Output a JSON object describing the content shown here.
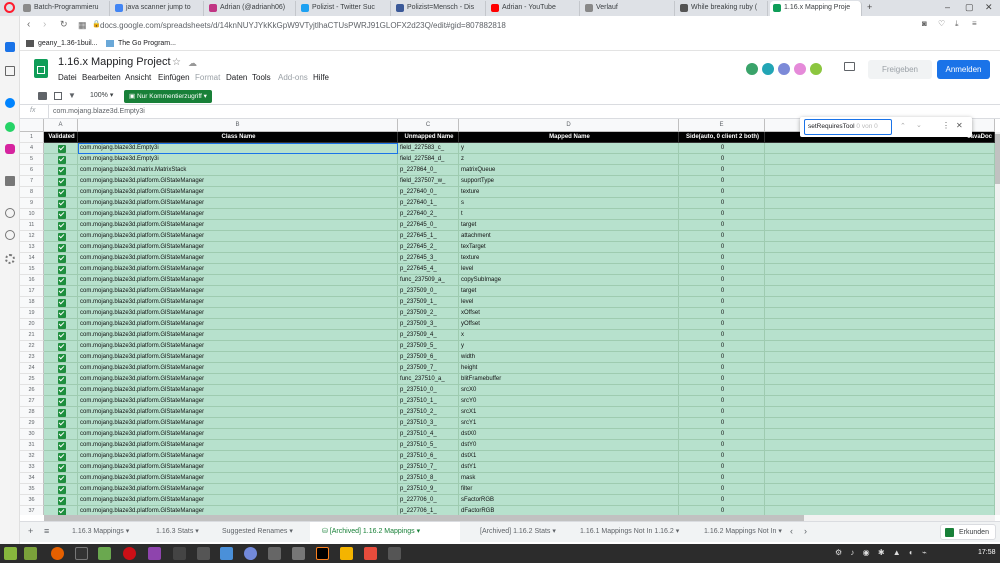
{
  "browser": {
    "tabs": [
      {
        "label": "Batch-Programmieru",
        "color": "#8a8a8a"
      },
      {
        "label": "java scanner jump to",
        "color": "#4285f4"
      },
      {
        "label": "Adrian (@adrianh06)",
        "color": "#c13584"
      },
      {
        "label": "Polizist - Twitter Suc",
        "color": "#1da1f2"
      },
      {
        "label": "Polizist=Mensch - Dis",
        "color": "#3b5998"
      },
      {
        "label": "Adrian - YouTube",
        "color": "#ff0000"
      },
      {
        "label": "Verlauf",
        "color": "#888888"
      },
      {
        "label": "While breaking ruby (",
        "color": "#555555"
      },
      {
        "label": "1.16.x Mapping Proje",
        "color": "#0f9d58"
      }
    ],
    "url": "docs.google.com/spreadsheets/d/14knNUYJYkKkGpW9VTyjtlhaCTUsPWRJ91GLOFX2d23Q/edit#gid=807882818",
    "bookmarks": [
      "geany_1.36-1buil...",
      "The Go Program..."
    ]
  },
  "docs": {
    "title": "1.16.x Mapping Project",
    "menu": [
      "Datei",
      "Bearbeiten",
      "Ansicht",
      "Einfügen",
      "Format",
      "Daten",
      "Tools",
      "Add-ons",
      "Hilfe"
    ],
    "share_button": "Freigeben",
    "signin_button": "Anmelden",
    "zoom": "100%",
    "mode": "Nur Kommentierzugriff",
    "formula_label": "fx",
    "formula_value": "com.mojang.blaze3d.Empty3i"
  },
  "find": {
    "query": "setRequiresTool",
    "count": "0 von 0"
  },
  "grid": {
    "col_letters": [
      "A",
      "B",
      "C",
      "D",
      "E"
    ],
    "headers": [
      "Validated",
      "Class Name",
      "Unmapped Name",
      "Mapped Name",
      "Side(auto, 0 client 2 both)",
      "JavaDoc"
    ],
    "header_rownum": "1",
    "rows": [
      {
        "n": "4",
        "cls": "com.mojang.blaze3d.Empty3i",
        "un": "field_227583_c_",
        "mapped": "y",
        "side": "0"
      },
      {
        "n": "5",
        "cls": "com.mojang.blaze3d.Empty3i",
        "un": "field_227584_d_",
        "mapped": "z",
        "side": "0"
      },
      {
        "n": "6",
        "cls": "com.mojang.blaze3d.matrix.MatrixStack",
        "un": "p_227864_0_",
        "mapped": "matrixQueue",
        "side": "0"
      },
      {
        "n": "7",
        "cls": "com.mojang.blaze3d.platform.GlStateManager",
        "un": "field_237507_w_",
        "mapped": "supportType",
        "side": "0"
      },
      {
        "n": "8",
        "cls": "com.mojang.blaze3d.platform.GlStateManager",
        "un": "p_227640_0_",
        "mapped": "texture",
        "side": "0"
      },
      {
        "n": "9",
        "cls": "com.mojang.blaze3d.platform.GlStateManager",
        "un": "p_227640_1_",
        "mapped": "s",
        "side": "0"
      },
      {
        "n": "10",
        "cls": "com.mojang.blaze3d.platform.GlStateManager",
        "un": "p_227640_2_",
        "mapped": "t",
        "side": "0"
      },
      {
        "n": "11",
        "cls": "com.mojang.blaze3d.platform.GlStateManager",
        "un": "p_227645_0_",
        "mapped": "target",
        "side": "0"
      },
      {
        "n": "12",
        "cls": "com.mojang.blaze3d.platform.GlStateManager",
        "un": "p_227645_1_",
        "mapped": "attachment",
        "side": "0"
      },
      {
        "n": "13",
        "cls": "com.mojang.blaze3d.platform.GlStateManager",
        "un": "p_227645_2_",
        "mapped": "texTarget",
        "side": "0"
      },
      {
        "n": "14",
        "cls": "com.mojang.blaze3d.platform.GlStateManager",
        "un": "p_227645_3_",
        "mapped": "texture",
        "side": "0"
      },
      {
        "n": "15",
        "cls": "com.mojang.blaze3d.platform.GlStateManager",
        "un": "p_227645_4_",
        "mapped": "level",
        "side": "0"
      },
      {
        "n": "16",
        "cls": "com.mojang.blaze3d.platform.GlStateManager",
        "un": "func_237509_a_",
        "mapped": "copySubImage",
        "side": "0"
      },
      {
        "n": "17",
        "cls": "com.mojang.blaze3d.platform.GlStateManager",
        "un": "p_237509_0_",
        "mapped": "target",
        "side": "0"
      },
      {
        "n": "18",
        "cls": "com.mojang.blaze3d.platform.GlStateManager",
        "un": "p_237509_1_",
        "mapped": "level",
        "side": "0"
      },
      {
        "n": "19",
        "cls": "com.mojang.blaze3d.platform.GlStateManager",
        "un": "p_237509_2_",
        "mapped": "xOffset",
        "side": "0"
      },
      {
        "n": "20",
        "cls": "com.mojang.blaze3d.platform.GlStateManager",
        "un": "p_237509_3_",
        "mapped": "yOffset",
        "side": "0"
      },
      {
        "n": "21",
        "cls": "com.mojang.blaze3d.platform.GlStateManager",
        "un": "p_237509_4_",
        "mapped": "x",
        "side": "0"
      },
      {
        "n": "22",
        "cls": "com.mojang.blaze3d.platform.GlStateManager",
        "un": "p_237509_5_",
        "mapped": "y",
        "side": "0"
      },
      {
        "n": "23",
        "cls": "com.mojang.blaze3d.platform.GlStateManager",
        "un": "p_237509_6_",
        "mapped": "width",
        "side": "0"
      },
      {
        "n": "24",
        "cls": "com.mojang.blaze3d.platform.GlStateManager",
        "un": "p_237509_7_",
        "mapped": "height",
        "side": "0"
      },
      {
        "n": "25",
        "cls": "com.mojang.blaze3d.platform.GlStateManager",
        "un": "func_237510_a_",
        "mapped": "blitFramebuffer",
        "side": "0"
      },
      {
        "n": "26",
        "cls": "com.mojang.blaze3d.platform.GlStateManager",
        "un": "p_237510_0_",
        "mapped": "srcX0",
        "side": "0"
      },
      {
        "n": "27",
        "cls": "com.mojang.blaze3d.platform.GlStateManager",
        "un": "p_237510_1_",
        "mapped": "srcY0",
        "side": "0"
      },
      {
        "n": "28",
        "cls": "com.mojang.blaze3d.platform.GlStateManager",
        "un": "p_237510_2_",
        "mapped": "srcX1",
        "side": "0"
      },
      {
        "n": "29",
        "cls": "com.mojang.blaze3d.platform.GlStateManager",
        "un": "p_237510_3_",
        "mapped": "srcY1",
        "side": "0"
      },
      {
        "n": "30",
        "cls": "com.mojang.blaze3d.platform.GlStateManager",
        "un": "p_237510_4_",
        "mapped": "dstX0",
        "side": "0"
      },
      {
        "n": "31",
        "cls": "com.mojang.blaze3d.platform.GlStateManager",
        "un": "p_237510_5_",
        "mapped": "dstY0",
        "side": "0"
      },
      {
        "n": "32",
        "cls": "com.mojang.blaze3d.platform.GlStateManager",
        "un": "p_237510_6_",
        "mapped": "dstX1",
        "side": "0"
      },
      {
        "n": "33",
        "cls": "com.mojang.blaze3d.platform.GlStateManager",
        "un": "p_237510_7_",
        "mapped": "dstY1",
        "side": "0"
      },
      {
        "n": "34",
        "cls": "com.mojang.blaze3d.platform.GlStateManager",
        "un": "p_237510_8_",
        "mapped": "mask",
        "side": "0"
      },
      {
        "n": "35",
        "cls": "com.mojang.blaze3d.platform.GlStateManager",
        "un": "p_237510_9_",
        "mapped": "filter",
        "side": "0"
      },
      {
        "n": "36",
        "cls": "com.mojang.blaze3d.platform.GlStateManager",
        "un": "p_227706_0_",
        "mapped": "sFactorRGB",
        "side": "0"
      },
      {
        "n": "37",
        "cls": "com.mojang.blaze3d.platform.GlStateManager",
        "un": "p_227706_1_",
        "mapped": "dFactorRGB",
        "side": "0"
      }
    ]
  },
  "sheet_tabs": [
    "1.16.3 Mappings",
    "1.16.3 Stats",
    "Suggested Renames",
    "[Archived] 1.16.2 Mappings",
    "[Archived] 1.16.2 Stats",
    "1.16.1 Mappings Not In 1.16.2",
    "1.16.2 Mappings Not In"
  ],
  "explore_label": "Erkunden",
  "clock": "17:58",
  "colors": {
    "accent": "#1a73e8",
    "row_green": "#b7e1cd",
    "sheets_green": "#188038"
  }
}
